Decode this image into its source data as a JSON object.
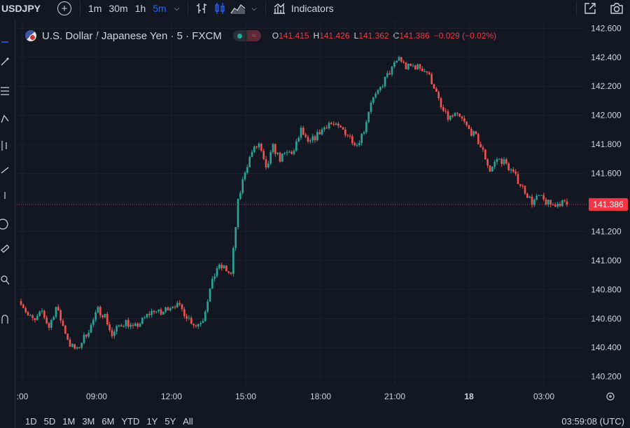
{
  "toolbar": {
    "symbol": "USDJPY",
    "timeframes": [
      "1m",
      "30m",
      "1h",
      "5m"
    ],
    "active_timeframe": "5m",
    "indicators_label": "Indicators"
  },
  "legend": {
    "title": "U.S. Dollar / Japanese Yen · 5 · FXCM",
    "o_label": "O",
    "o_value": "141.415",
    "h_label": "H",
    "h_value": "141.426",
    "l_label": "L",
    "l_value": "141.362",
    "c_label": "C",
    "c_value": "141.386",
    "change": "−0.029 (−0.02%)"
  },
  "colors": {
    "background": "#131722",
    "up": "#26a69a",
    "down": "#ef5350",
    "price_label_bg": "#f23645",
    "grid": "#1e222d",
    "accent": "#2962ff"
  },
  "chart_data": {
    "type": "candlestick",
    "symbol": "USDJPY",
    "interval": "5",
    "ylim": [
      140.15,
      142.65
    ],
    "y_ticks": [
      "142.600",
      "142.400",
      "142.200",
      "142.000",
      "141.800",
      "141.600",
      "141.400",
      "141.200",
      "141.000",
      "140.800",
      "140.600",
      "140.400",
      "140.200"
    ],
    "x_ticks": [
      ":00",
      "09:00",
      "12:00",
      "15:00",
      "18:00",
      "21:00",
      "18",
      "03:00"
    ],
    "current_price": "141.386",
    "close_path": [
      140.72,
      140.62,
      140.58,
      140.65,
      140.54,
      140.68,
      140.55,
      140.42,
      140.38,
      140.47,
      140.55,
      140.66,
      140.62,
      140.48,
      140.55,
      140.58,
      140.53,
      140.57,
      140.62,
      140.66,
      140.63,
      140.68,
      140.7,
      140.66,
      140.6,
      140.55,
      140.6,
      140.8,
      140.95,
      140.95,
      140.9,
      141.4,
      141.62,
      141.75,
      141.8,
      141.62,
      141.78,
      141.7,
      141.74,
      141.75,
      141.9,
      141.8,
      141.85,
      141.9,
      141.95,
      141.92,
      141.9,
      141.85,
      141.8,
      141.9,
      142.1,
      142.15,
      142.25,
      142.32,
      142.4,
      142.33,
      142.34,
      142.33,
      142.3,
      142.2,
      142.05,
      141.98,
      142.0,
      141.97,
      141.9,
      141.85,
      141.75,
      141.62,
      141.7,
      141.68,
      141.62,
      141.55,
      141.48,
      141.4,
      141.44,
      141.4,
      141.38,
      141.4,
      141.386
    ]
  },
  "range_buttons": [
    "1D",
    "5D",
    "1M",
    "3M",
    "6M",
    "YTD",
    "1Y",
    "5Y",
    "All"
  ],
  "clock": "03:59:08 (UTC)"
}
